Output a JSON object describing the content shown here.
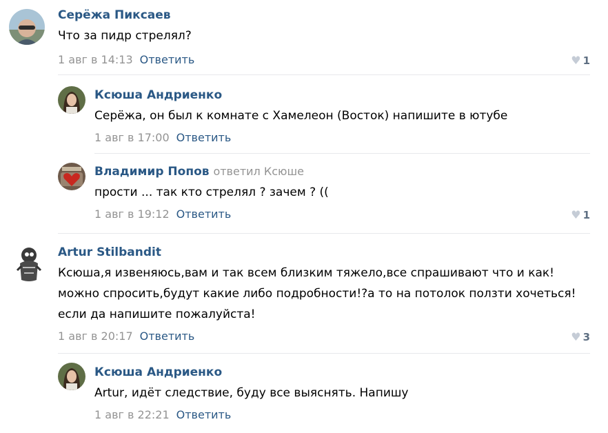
{
  "comments": [
    {
      "author": "Серёжа Пиксаев",
      "reply_to": "",
      "text": "Что за пидр стрелял?",
      "date": "1 авг в 14:13",
      "reply_label": "Ответить",
      "likes": "1",
      "avatar_icon": "user-photo-icon"
    },
    {
      "author": "Ксюша Андриенко",
      "reply_to": "",
      "text": "Серёжа, он был к комнате с Хамелеон (Восток) напишите в ютубе",
      "date": "1 авг в 17:00",
      "reply_label": "Ответить",
      "likes": "",
      "avatar_icon": "user-photo-icon"
    },
    {
      "author": "Владимир Попов",
      "reply_to": "ответил Ксюше",
      "text": "прости ... так кто стрелял ? зачем ? ((",
      "date": "1 авг в 19:12",
      "reply_label": "Ответить",
      "likes": "1",
      "avatar_icon": "user-photo-icon"
    },
    {
      "author": "Artur Stilbandit",
      "reply_to": "",
      "text": "Ксюша,я извеняюсь,вам и так всем близким тяжело,все спрашивают что и как!можно спросить,будут какие либо подробности!?а то на потолок ползти хочеться!если да напишите пожалуйста!",
      "date": "1 авг в 20:17",
      "reply_label": "Ответить",
      "likes": "3",
      "avatar_icon": "user-photo-icon"
    },
    {
      "author": "Ксюша Андриенко",
      "reply_to": "",
      "text": "Artur, идёт следствие, буду все выяснять. Напишу",
      "date": "1 авг в 22:21",
      "reply_label": "Ответить",
      "likes": "",
      "avatar_icon": "user-photo-icon"
    }
  ],
  "like_icon": "heart-icon",
  "colors": {
    "author_link": "#2a5885",
    "meta_gray": "#939393",
    "heart": "#c5ccd6",
    "separator": "#e7e8ec"
  }
}
